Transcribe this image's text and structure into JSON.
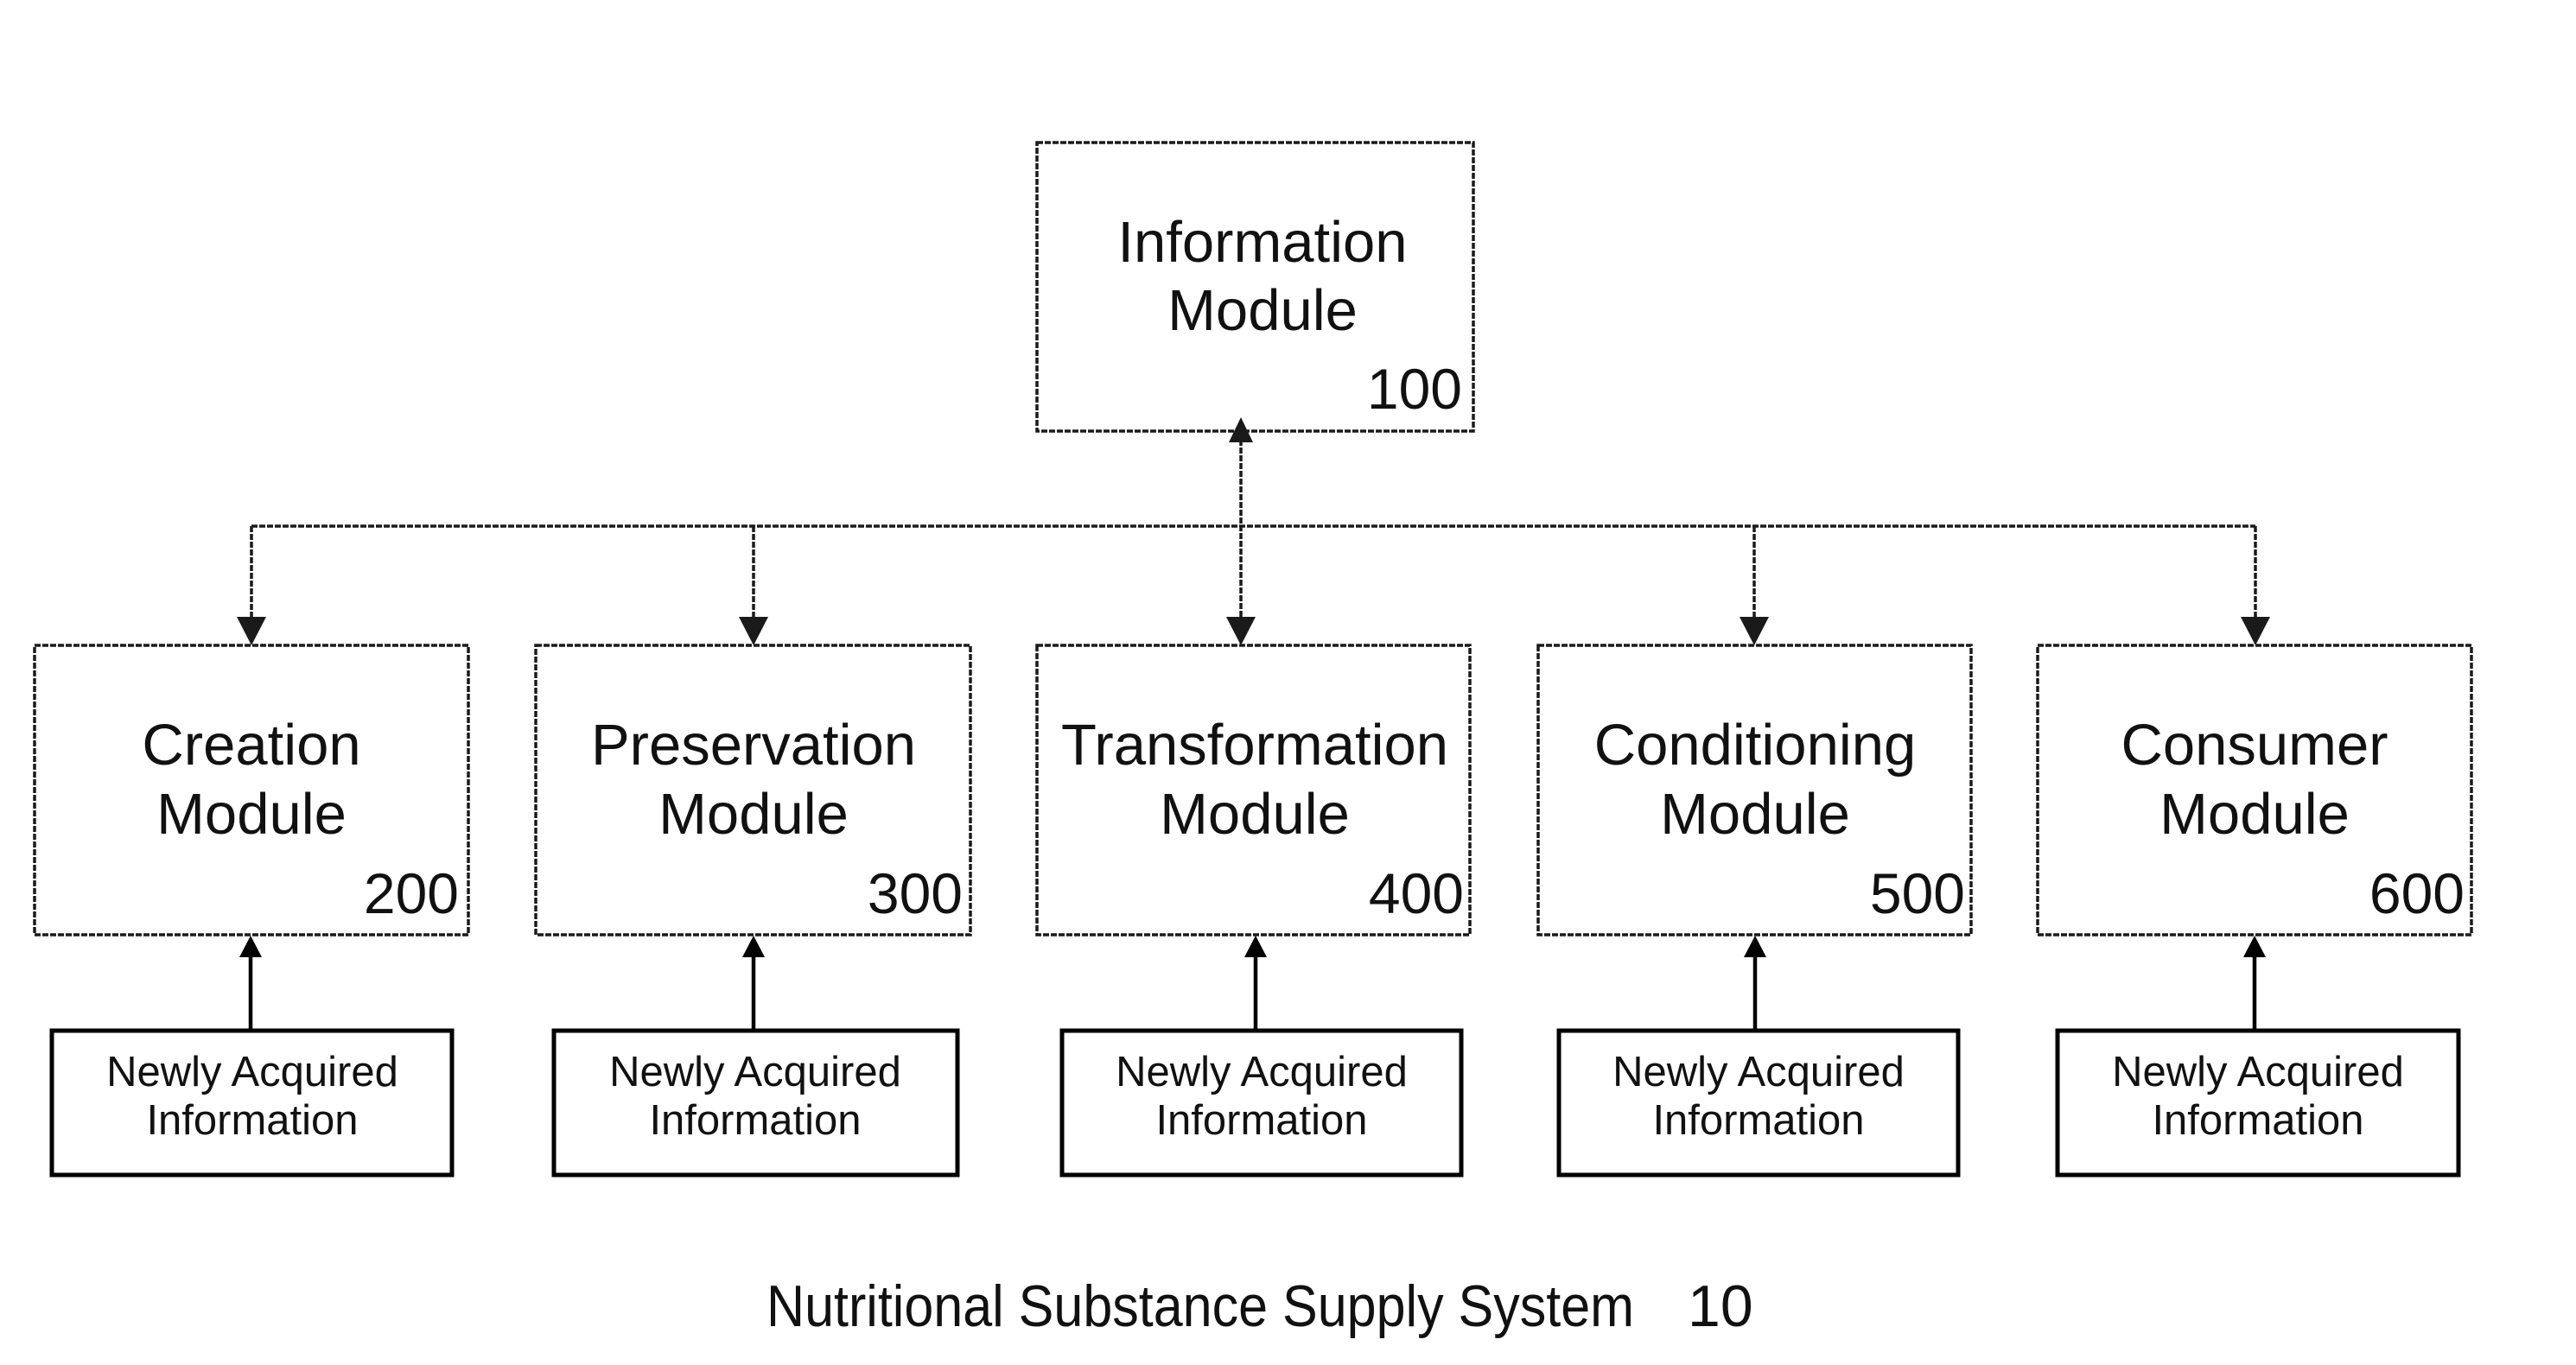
{
  "diagram": {
    "caption": {
      "title": "Nutritional Substance Supply System",
      "ref": "10"
    },
    "info_module": {
      "line1": "Information",
      "line2": "Module",
      "ref": "100"
    },
    "modules": [
      {
        "line1": "Creation",
        "line2": "Module",
        "ref": "200"
      },
      {
        "line1": "Preservation",
        "line2": "Module",
        "ref": "300"
      },
      {
        "line1": "Transformation",
        "line2": "Module",
        "ref": "400"
      },
      {
        "line1": "Conditioning",
        "line2": "Module",
        "ref": "500"
      },
      {
        "line1": "Consumer",
        "line2": "Module",
        "ref": "600"
      }
    ],
    "inputs": [
      {
        "line1": "Newly Acquired",
        "line2": "Information"
      },
      {
        "line1": "Newly Acquired",
        "line2": "Information"
      },
      {
        "line1": "Newly Acquired",
        "line2": "Information"
      },
      {
        "line1": "Newly Acquired",
        "line2": "Information"
      },
      {
        "line1": "Newly Acquired",
        "line2": "Information"
      }
    ],
    "connections": [
      {
        "from": "Information Module",
        "to": "Creation Module",
        "style": "dotted",
        "direction": "to"
      },
      {
        "from": "Information Module",
        "to": "Preservation Module",
        "style": "dotted",
        "direction": "to"
      },
      {
        "from": "Information Module",
        "to": "Transformation Module",
        "style": "dotted",
        "direction": "bidirectional"
      },
      {
        "from": "Information Module",
        "to": "Conditioning Module",
        "style": "dotted",
        "direction": "to"
      },
      {
        "from": "Information Module",
        "to": "Consumer Module",
        "style": "dotted",
        "direction": "to"
      },
      {
        "from": "Newly Acquired Information",
        "to": "Creation Module",
        "style": "solid",
        "direction": "to"
      },
      {
        "from": "Newly Acquired Information",
        "to": "Preservation Module",
        "style": "solid",
        "direction": "to"
      },
      {
        "from": "Newly Acquired Information",
        "to": "Transformation Module",
        "style": "solid",
        "direction": "to"
      },
      {
        "from": "Newly Acquired Information",
        "to": "Conditioning Module",
        "style": "solid",
        "direction": "to"
      },
      {
        "from": "Newly Acquired Information",
        "to": "Consumer Module",
        "style": "solid",
        "direction": "to"
      }
    ]
  }
}
